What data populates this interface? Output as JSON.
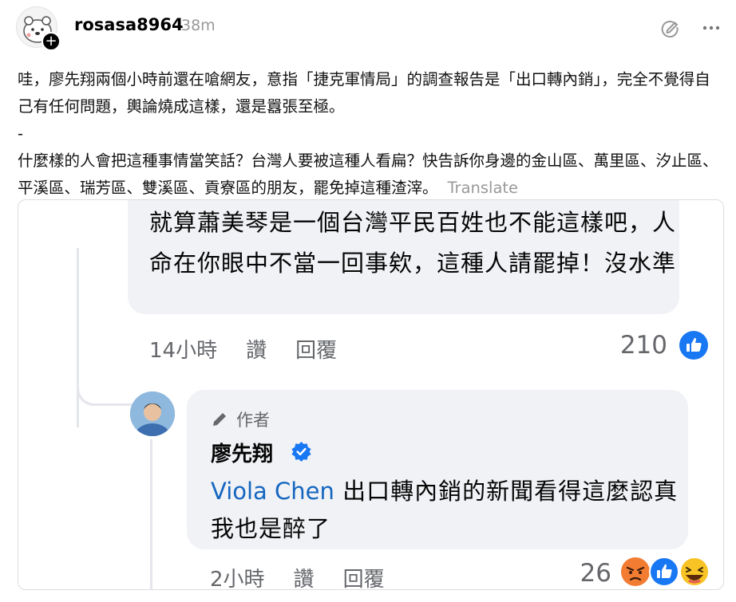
{
  "post": {
    "username": "rosasa8964",
    "timestamp": "38m",
    "follow_symbol": "+",
    "paragraph1": "哇，廖先翔兩個小時前還在嗆網友，意指「捷克軍情局」的調查報告是「出口轉內銷」，完全不覺得自己有任何問題，輿論燒成這樣，還是囂張至極。",
    "separator": "-",
    "paragraph2": "什麼樣的人會把這種事情當笑話？台灣人要被這種人看扁？快告訴你身邊的金山區、萬里區、汐止區、平溪區、瑞芳區、雙溪區、貢寮區的朋友，罷免掉這種渣滓。",
    "translate_label": "Translate"
  },
  "embed": {
    "comment1": {
      "text": "就算蕭美琴是一個台灣平民百姓也不能這樣吧，人命在你眼中不當一回事欸，這種人請罷掉！沒水準",
      "time": "14小時",
      "like_label": "讚",
      "reply_label": "回覆",
      "reaction_count": "210"
    },
    "comment2": {
      "author_tag": "作者",
      "author_name": "廖先翔",
      "mention": "Viola Chen",
      "text": "出口轉內銷的新聞看得這麼認真我也是醉了",
      "time": "2小時",
      "like_label": "讚",
      "reply_label": "回覆",
      "reaction_count": "26"
    }
  },
  "colors": {
    "secondary_text": "#999999",
    "fb_blue": "#1877f2",
    "mention_blue": "#1566c0",
    "bubble_bg": "#f0f2f5"
  },
  "icons": [
    "edit-icon",
    "more-icon",
    "pen-icon",
    "verified-icon",
    "like-icon",
    "angry-icon",
    "laugh-icon"
  ]
}
